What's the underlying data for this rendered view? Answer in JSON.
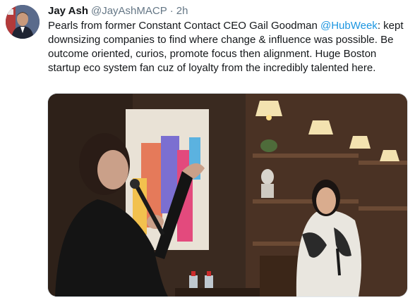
{
  "tweet": {
    "author": {
      "display_name": "Jay Ash",
      "handle": "@JayAshMACP",
      "separator": "·",
      "time": "2h"
    },
    "text": {
      "part1": "Pearls from former Constant Contact CEO Gail Goodman ",
      "mention": "@HubWeek",
      "part2": ": kept downsizing companies to find where change & influence was possible. Be outcome oriented, curios, promote focus then alignment. Huge Boston startup eco system fan cuz of loyalty from the incredibly talented here."
    },
    "media": {
      "type": "photo",
      "description_icon": "photo-of-two-women-on-stage"
    },
    "colors": {
      "link": "#1b95e0",
      "text": "#14171a",
      "secondary": "#657786"
    }
  }
}
